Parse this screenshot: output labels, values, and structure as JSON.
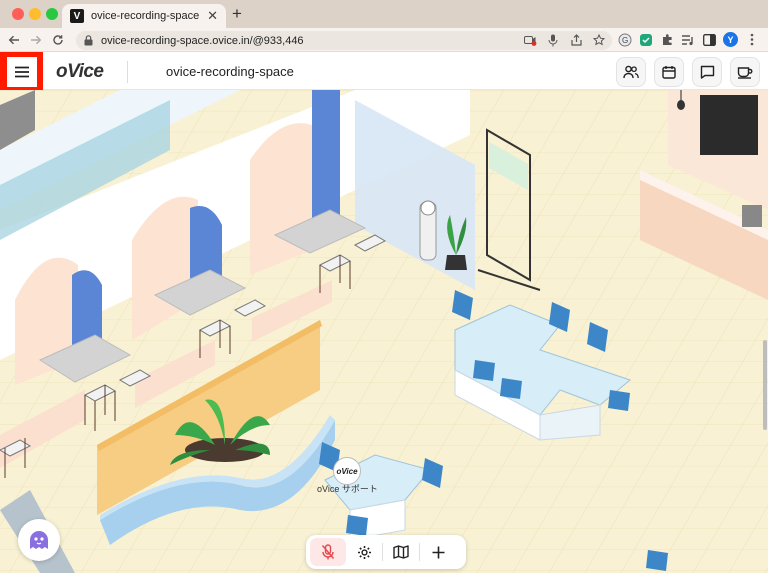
{
  "browser": {
    "tab_title": "ovice-recording-space | oVice",
    "favicon_letter": "V",
    "url": "ovice-recording-space.ovice.in/@933,446",
    "profile_initial": "Y"
  },
  "header": {
    "logo": "oVice",
    "space_name": "ovice-recording-space",
    "menu_icon": "hamburger-icon",
    "buttons": [
      "members-icon",
      "calendar-icon",
      "chat-icon",
      "coffee-icon"
    ]
  },
  "map": {
    "support_badge": "oVice",
    "support_label": "oVice サポート"
  },
  "toolbar": {
    "icons": [
      "mic-muted-icon",
      "settings-icon",
      "map-icon",
      "plus-icon"
    ]
  },
  "colors": {
    "menu_highlight": "#ff1a00",
    "floor": "#f7efcf",
    "desk": "#d7eef8",
    "chair": "#3d87c8",
    "accent_blue": "#1a73e8"
  }
}
